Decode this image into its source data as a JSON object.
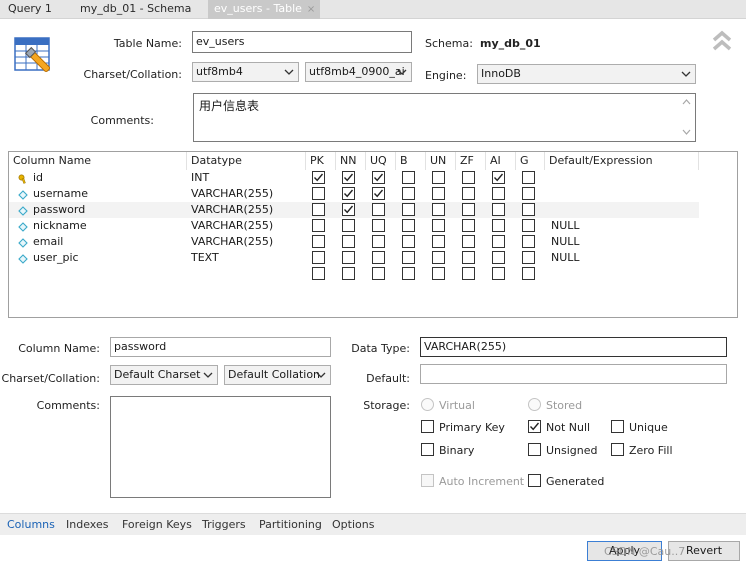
{
  "tabs": [
    {
      "label": "Query 1"
    },
    {
      "label": "my_db_01 - Schema"
    },
    {
      "label": "ev_users - Table",
      "close": "×"
    }
  ],
  "table": {
    "name_label": "Table Name:",
    "name_value": "ev_users",
    "schema_label": "Schema:",
    "schema_value": "my_db_01",
    "charset_label": "Charset/Collation:",
    "charset_value": "utf8mb4",
    "collation_value": "utf8mb4_0900_ai",
    "engine_label": "Engine:",
    "engine_value": "InnoDB",
    "comments_label": "Comments:",
    "comments_value": "用户信息表"
  },
  "grid": {
    "headers": [
      "Column Name",
      "Datatype",
      "PK",
      "NN",
      "UQ",
      "B",
      "UN",
      "ZF",
      "AI",
      "G",
      "Default/Expression"
    ],
    "rows": [
      {
        "name": "id",
        "type": "INT",
        "flags": [
          true,
          true,
          true,
          false,
          false,
          false,
          true,
          false
        ],
        "default": "",
        "icon": "key-icon"
      },
      {
        "name": "username",
        "type": "VARCHAR(255)",
        "flags": [
          false,
          true,
          true,
          false,
          false,
          false,
          false,
          false
        ],
        "default": "",
        "icon": "column-icon"
      },
      {
        "name": "password",
        "type": "VARCHAR(255)",
        "flags": [
          false,
          true,
          false,
          false,
          false,
          false,
          false,
          false
        ],
        "default": "",
        "icon": "column-icon"
      },
      {
        "name": "nickname",
        "type": "VARCHAR(255)",
        "flags": [
          false,
          false,
          false,
          false,
          false,
          false,
          false,
          false
        ],
        "default": "NULL",
        "icon": "column-icon"
      },
      {
        "name": "email",
        "type": "VARCHAR(255)",
        "flags": [
          false,
          false,
          false,
          false,
          false,
          false,
          false,
          false
        ],
        "default": "NULL",
        "icon": "column-icon"
      },
      {
        "name": "user_pic",
        "type": "TEXT",
        "flags": [
          false,
          false,
          false,
          false,
          false,
          false,
          false,
          false
        ],
        "default": "NULL",
        "icon": "column-icon"
      }
    ],
    "selected_index": 2
  },
  "details": {
    "column_name_label": "Column Name:",
    "column_name_value": "password",
    "data_type_label": "Data Type:",
    "data_type_value": "VARCHAR(255)",
    "charset_label": "Charset/Collation:",
    "charset_value": "Default Charset",
    "collation_value": "Default Collation",
    "default_label": "Default:",
    "default_value": "",
    "comments_label": "Comments:",
    "storage_label": "Storage:",
    "virtual_label": "Virtual",
    "stored_label": "Stored",
    "primary_key_label": "Primary Key",
    "not_null_label": "Not Null",
    "unique_label": "Unique",
    "binary_label": "Binary",
    "unsigned_label": "Unsigned",
    "zero_fill_label": "Zero Fill",
    "auto_increment_label": "Auto Increment",
    "generated_label": "Generated",
    "checks": {
      "primary_key": false,
      "not_null": true,
      "unique": false,
      "binary": false,
      "unsigned": false,
      "zero_fill": false,
      "auto_increment": false,
      "generated": false
    }
  },
  "bottom_tabs": [
    "Columns",
    "Indexes",
    "Foreign Keys",
    "Triggers",
    "Partitioning",
    "Options"
  ],
  "buttons": {
    "apply": "Apply",
    "revert": "Revert"
  },
  "watermark": "CSDN @Cau..7",
  "colors": {
    "accent_tab": "#1a62b5",
    "key_icon": "#e8b400",
    "column_icon": "#3aa9c9"
  }
}
